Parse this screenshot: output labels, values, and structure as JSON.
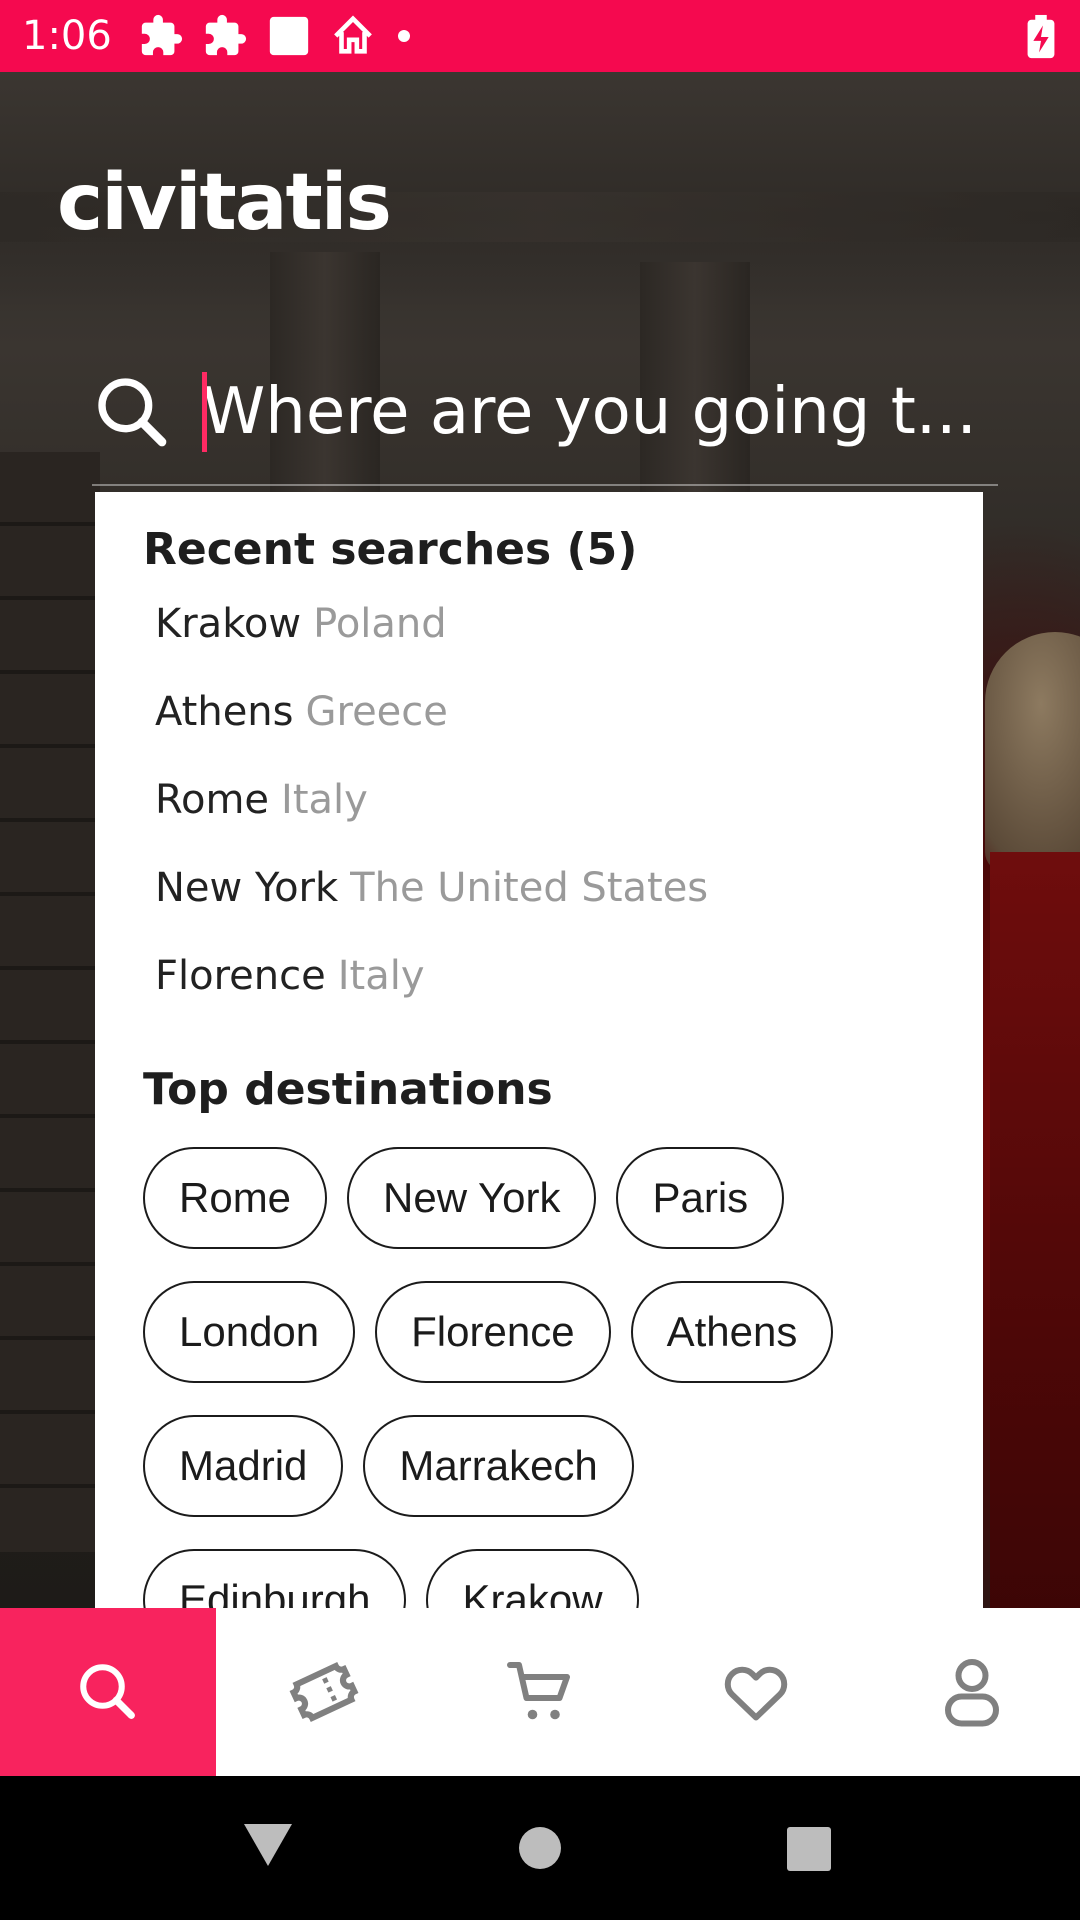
{
  "status_bar": {
    "time": "1:06"
  },
  "brand": {
    "logo": "civitatis",
    "accent": "#f8235e",
    "status_color": "#f5094f"
  },
  "search": {
    "placeholder": "Where are you going t..."
  },
  "recent": {
    "title": "Recent searches (5)",
    "items": [
      {
        "city": "Krakow",
        "country": "Poland"
      },
      {
        "city": "Athens",
        "country": "Greece"
      },
      {
        "city": "Rome",
        "country": "Italy"
      },
      {
        "city": "New York",
        "country": "The United States"
      },
      {
        "city": "Florence",
        "country": "Italy"
      }
    ]
  },
  "top": {
    "title": "Top destinations",
    "chips": [
      "Rome",
      "New York",
      "Paris",
      "London",
      "Florence",
      "Athens",
      "Madrid",
      "Marrakech",
      "Edinburgh",
      "Krakow"
    ]
  },
  "nav": {
    "items": [
      {
        "icon": "search-icon",
        "active": true
      },
      {
        "icon": "ticket-icon",
        "active": false
      },
      {
        "icon": "cart-icon",
        "active": false
      },
      {
        "icon": "heart-icon",
        "active": false
      },
      {
        "icon": "profile-icon",
        "active": false
      }
    ]
  }
}
